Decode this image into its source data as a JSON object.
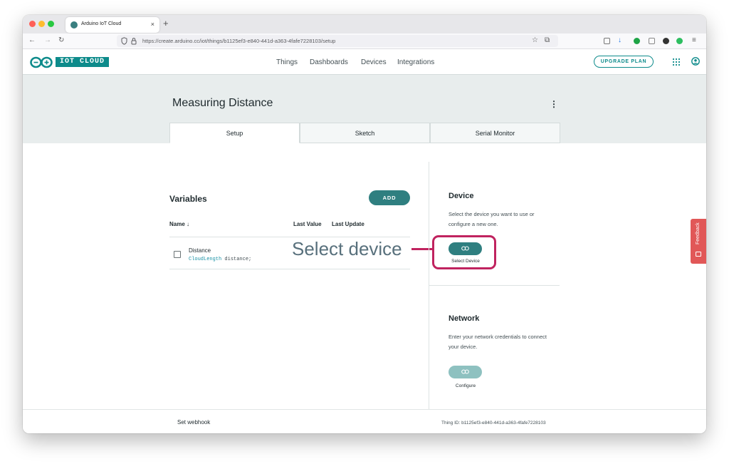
{
  "browser": {
    "tab_title": "Arduino IoT Cloud",
    "tab_close": "×",
    "new_tab": "+",
    "url": "https://create.arduino.cc/iot/things/b1125ef3-e840-441d-a363-4fafe7228103/setup",
    "traffic_lights": [
      "#ff5f57",
      "#febc2e",
      "#28c840"
    ]
  },
  "header": {
    "brand": "IOT CLOUD",
    "brand_color": "#0d8b8b",
    "nav": [
      "Things",
      "Dashboards",
      "Devices",
      "Integrations"
    ],
    "upgrade_label": "UPGRADE PLAN"
  },
  "thing": {
    "title": "Measuring Distance",
    "menu": "⋮",
    "tabs": [
      "Setup",
      "Sketch",
      "Serial Monitor"
    ],
    "active_tab": "Setup"
  },
  "variables": {
    "title": "Variables",
    "add_label": "ADD",
    "columns": {
      "name": "Name ↓",
      "last_value": "Last Value",
      "last_update": "Last Update"
    },
    "rows": [
      {
        "name": "Distance",
        "type": "CloudLength",
        "declaration": " distance;"
      }
    ]
  },
  "annotation": {
    "text": "Select device",
    "color": "#c0235f"
  },
  "device": {
    "title": "Device",
    "description": "Select the device you want to use or configure a new one.",
    "button_label": "Select Device"
  },
  "network": {
    "title": "Network",
    "description": "Enter your network credentials to connect your device.",
    "button_label": "Configure"
  },
  "footer": {
    "webhook": "Set webhook",
    "thing_id": "Thing ID:  b1125ef3-e840-441d-a363-4fafe7228103"
  },
  "feedback": {
    "label": "Feedback"
  }
}
